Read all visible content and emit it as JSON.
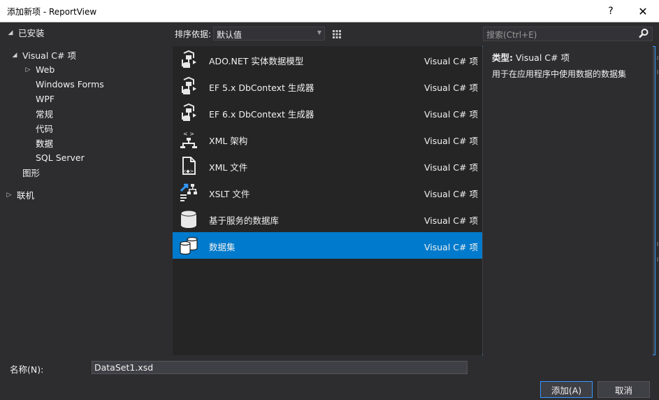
{
  "window": {
    "title": "添加新项 - ReportView",
    "help_label": "?",
    "close_label": "✕"
  },
  "tree": {
    "installed": "已安装",
    "visual_csharp": "Visual C# 项",
    "children": [
      "Web",
      "Windows Forms",
      "WPF",
      "常规",
      "代码",
      "数据",
      "SQL Server"
    ],
    "graphics": "图形",
    "online": "联机",
    "selected": "数据"
  },
  "toolbar": {
    "sort_label": "排序依据:",
    "sort_value": "默认值"
  },
  "search": {
    "placeholder": "搜索(Ctrl+E)"
  },
  "templates": [
    {
      "name": "ADO.NET 实体数据模型",
      "lang": "Visual C# 项",
      "icon": "entity-model-icon"
    },
    {
      "name": "EF 5.x DbContext 生成器",
      "lang": "Visual C# 项",
      "icon": "dbcontext-generator-icon"
    },
    {
      "name": "EF 6.x DbContext 生成器",
      "lang": "Visual C# 项",
      "icon": "dbcontext-generator-icon"
    },
    {
      "name": "XML 架构",
      "lang": "Visual C# 项",
      "icon": "xml-schema-icon"
    },
    {
      "name": "XML 文件",
      "lang": "Visual C# 项",
      "icon": "xml-file-icon"
    },
    {
      "name": "XSLT 文件",
      "lang": "Visual C# 项",
      "icon": "xslt-file-icon"
    },
    {
      "name": "基于服务的数据库",
      "lang": "Visual C# 项",
      "icon": "database-icon"
    },
    {
      "name": "数据集",
      "lang": "Visual C# 项",
      "icon": "dataset-icon"
    }
  ],
  "selected_template": "数据集",
  "info": {
    "type_label": "类型:",
    "type_value": "Visual C# 项",
    "description": "用于在应用程序中使用数据的数据集"
  },
  "bottom": {
    "name_label": "名称(N):",
    "name_value": "DataSet1.xsd",
    "add_label": "添加(A)",
    "cancel_label": "取消"
  },
  "colors": {
    "background": "#2d2d30",
    "list_background": "#252526",
    "selection": "#007acc",
    "accent_border": "#3399ff"
  }
}
